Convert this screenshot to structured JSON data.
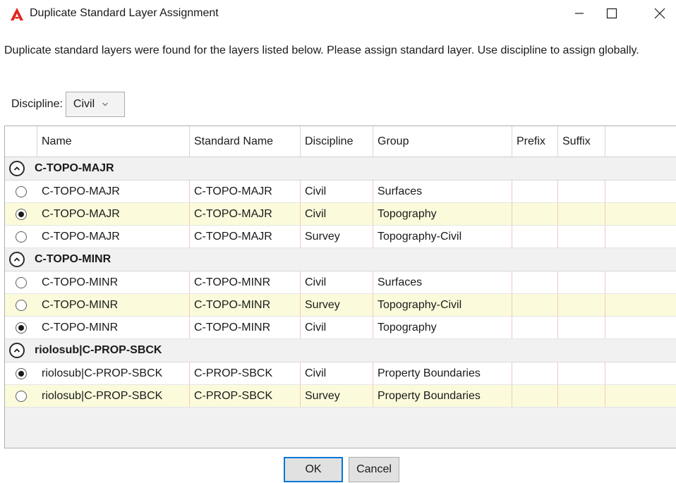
{
  "window": {
    "title": "Duplicate Standard Layer Assignment",
    "icons": [
      "app-logo-icon",
      "minimize-icon",
      "maximize-icon",
      "close-icon"
    ],
    "accent_color": "#e1251b"
  },
  "message": "Duplicate standard layers were found for the layers listed below. Please assign standard layer. Use discipline to assign globally.",
  "discipline": {
    "label": "Discipline:",
    "value": "Civil"
  },
  "grid": {
    "columns": [
      "Name",
      "Standard Name",
      "Discipline",
      "Group",
      "Prefix",
      "Suffix"
    ],
    "groups": [
      {
        "title": "C-TOPO-MAJR",
        "rows": [
          {
            "selected": false,
            "name": "C-TOPO-MAJR",
            "standard_name": "C-TOPO-MAJR",
            "discipline": "Civil",
            "group": "Surfaces",
            "prefix": "",
            "suffix": ""
          },
          {
            "selected": true,
            "name": "C-TOPO-MAJR",
            "standard_name": "C-TOPO-MAJR",
            "discipline": "Civil",
            "group": "Topography",
            "prefix": "",
            "suffix": ""
          },
          {
            "selected": false,
            "name": "C-TOPO-MAJR",
            "standard_name": "C-TOPO-MAJR",
            "discipline": "Survey",
            "group": "Topography-Civil",
            "prefix": "",
            "suffix": ""
          }
        ]
      },
      {
        "title": "C-TOPO-MINR",
        "rows": [
          {
            "selected": false,
            "name": "C-TOPO-MINR",
            "standard_name": "C-TOPO-MINR",
            "discipline": "Civil",
            "group": "Surfaces",
            "prefix": "",
            "suffix": ""
          },
          {
            "selected": false,
            "name": "C-TOPO-MINR",
            "standard_name": "C-TOPO-MINR",
            "discipline": "Survey",
            "group": "Topography-Civil",
            "prefix": "",
            "suffix": ""
          },
          {
            "selected": true,
            "name": "C-TOPO-MINR",
            "standard_name": "C-TOPO-MINR",
            "discipline": "Civil",
            "group": "Topography",
            "prefix": "",
            "suffix": ""
          }
        ]
      },
      {
        "title": "riolosub|C-PROP-SBCK",
        "rows": [
          {
            "selected": true,
            "name": "riolosub|C-PROP-SBCK",
            "standard_name": "C-PROP-SBCK",
            "discipline": "Civil",
            "group": "Property Boundaries",
            "prefix": "",
            "suffix": ""
          },
          {
            "selected": false,
            "name": "riolosub|C-PROP-SBCK",
            "standard_name": "C-PROP-SBCK",
            "discipline": "Survey",
            "group": "Property Boundaries",
            "prefix": "",
            "suffix": ""
          }
        ]
      }
    ]
  },
  "buttons": {
    "ok": "OK",
    "cancel": "Cancel"
  }
}
